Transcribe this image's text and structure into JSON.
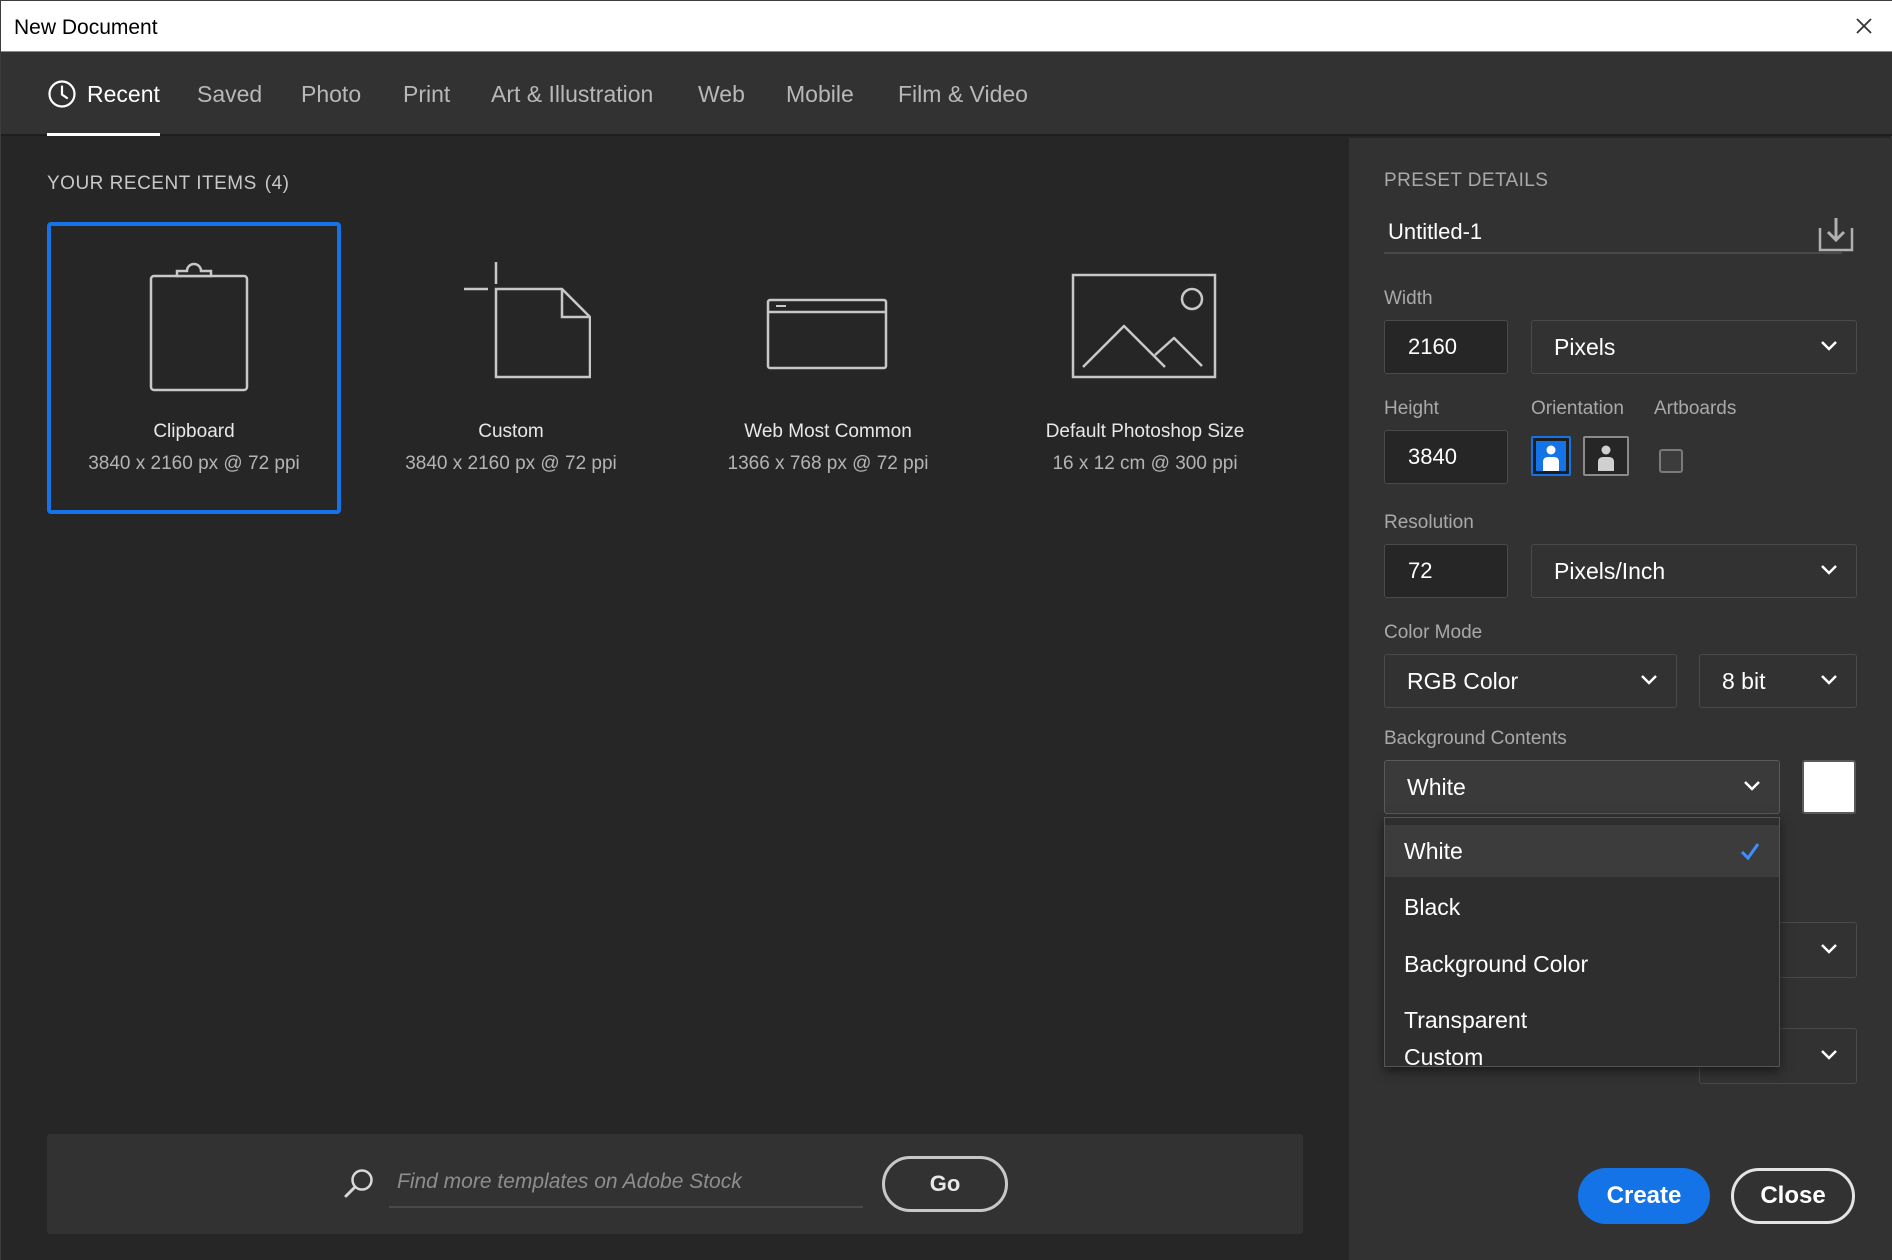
{
  "window": {
    "title": "New Document",
    "close_icon": "close-icon"
  },
  "tabs": [
    {
      "label": "Recent",
      "icon": "clock-icon",
      "active": true
    },
    {
      "label": "Saved"
    },
    {
      "label": "Photo"
    },
    {
      "label": "Print"
    },
    {
      "label": "Art & Illustration"
    },
    {
      "label": "Web"
    },
    {
      "label": "Mobile"
    },
    {
      "label": "Film & Video"
    }
  ],
  "recent": {
    "heading": "YOUR RECENT ITEMS",
    "count": "(4)",
    "items": [
      {
        "name": "Clipboard",
        "spec": "3840 x 2160 px @ 72 ppi",
        "icon": "clipboard-icon",
        "selected": true
      },
      {
        "name": "Custom",
        "spec": "3840 x 2160 px @ 72 ppi",
        "icon": "custom-document-icon"
      },
      {
        "name": "Web Most Common",
        "spec": "1366 x 768 px @ 72 ppi",
        "icon": "browser-window-icon"
      },
      {
        "name": "Default Photoshop Size",
        "spec": "16 x 12 cm @ 300 ppi",
        "icon": "image-icon"
      }
    ]
  },
  "search": {
    "placeholder": "Find more templates on Adobe Stock",
    "value": "",
    "go_label": "Go"
  },
  "preset": {
    "heading": "PRESET DETAILS",
    "name": "Untitled-1",
    "width_label": "Width",
    "width_value": "2160",
    "width_unit": "Pixels",
    "height_label": "Height",
    "height_value": "3840",
    "orientation_label": "Orientation",
    "orientation": "portrait",
    "artboards_label": "Artboards",
    "artboards_checked": false,
    "resolution_label": "Resolution",
    "resolution_value": "72",
    "resolution_unit": "Pixels/Inch",
    "color_mode_label": "Color Mode",
    "color_mode": "RGB Color",
    "bit_depth": "8 bit",
    "background_label": "Background Contents",
    "background_value": "White",
    "background_swatch": "#ffffff",
    "background_options": [
      "White",
      "Black",
      "Background Color",
      "Transparent",
      "Custom"
    ],
    "background_selected_index": 0
  },
  "actions": {
    "create": "Create",
    "close": "Close"
  },
  "colors": {
    "accent": "#1473e6",
    "panel": "#323232",
    "background": "#262626"
  }
}
